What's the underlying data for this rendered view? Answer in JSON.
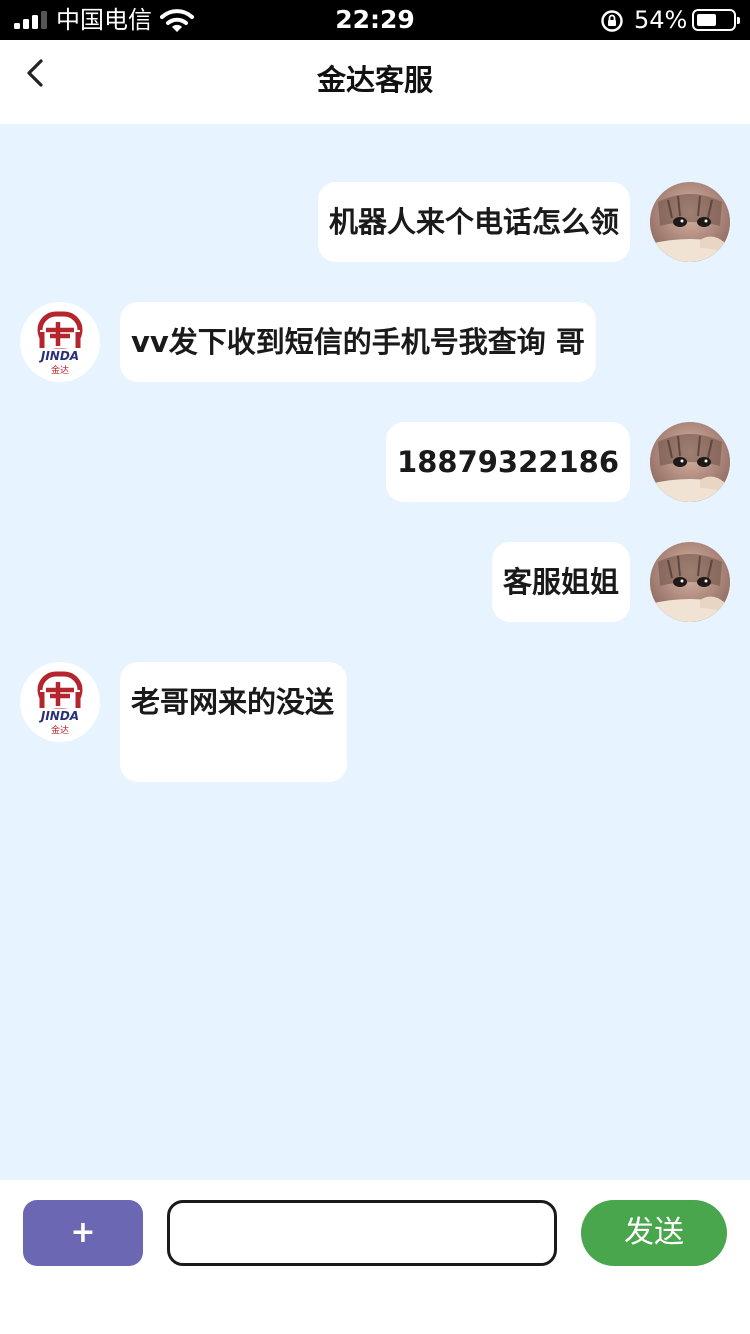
{
  "status_bar": {
    "carrier": "中国电信",
    "time": "22:29",
    "battery_percent": "54%",
    "battery_level": 0.54
  },
  "nav": {
    "title": "金达客服",
    "back_icon": "chevron-left-icon"
  },
  "bot_logo": {
    "brand_text": "JINDA",
    "brand_cn": "金达",
    "color": "#b5252d",
    "text_color": "#2a2f7a"
  },
  "messages": [
    {
      "sender": "user",
      "text": "机器人来个电话怎么领"
    },
    {
      "sender": "bot",
      "text": "vv发下收到短信的手机号我查询 哥"
    },
    {
      "sender": "user",
      "text": "18879322186"
    },
    {
      "sender": "user",
      "text": "客服姐姐"
    },
    {
      "sender": "bot",
      "text": "老哥网来的没送"
    }
  ],
  "input_bar": {
    "plus_label": "+",
    "input_value": "",
    "send_label": "发送"
  },
  "colors": {
    "chat_background": "#e7f4ff",
    "plus_button": "#6b67b3",
    "send_button": "#4aa64c"
  }
}
